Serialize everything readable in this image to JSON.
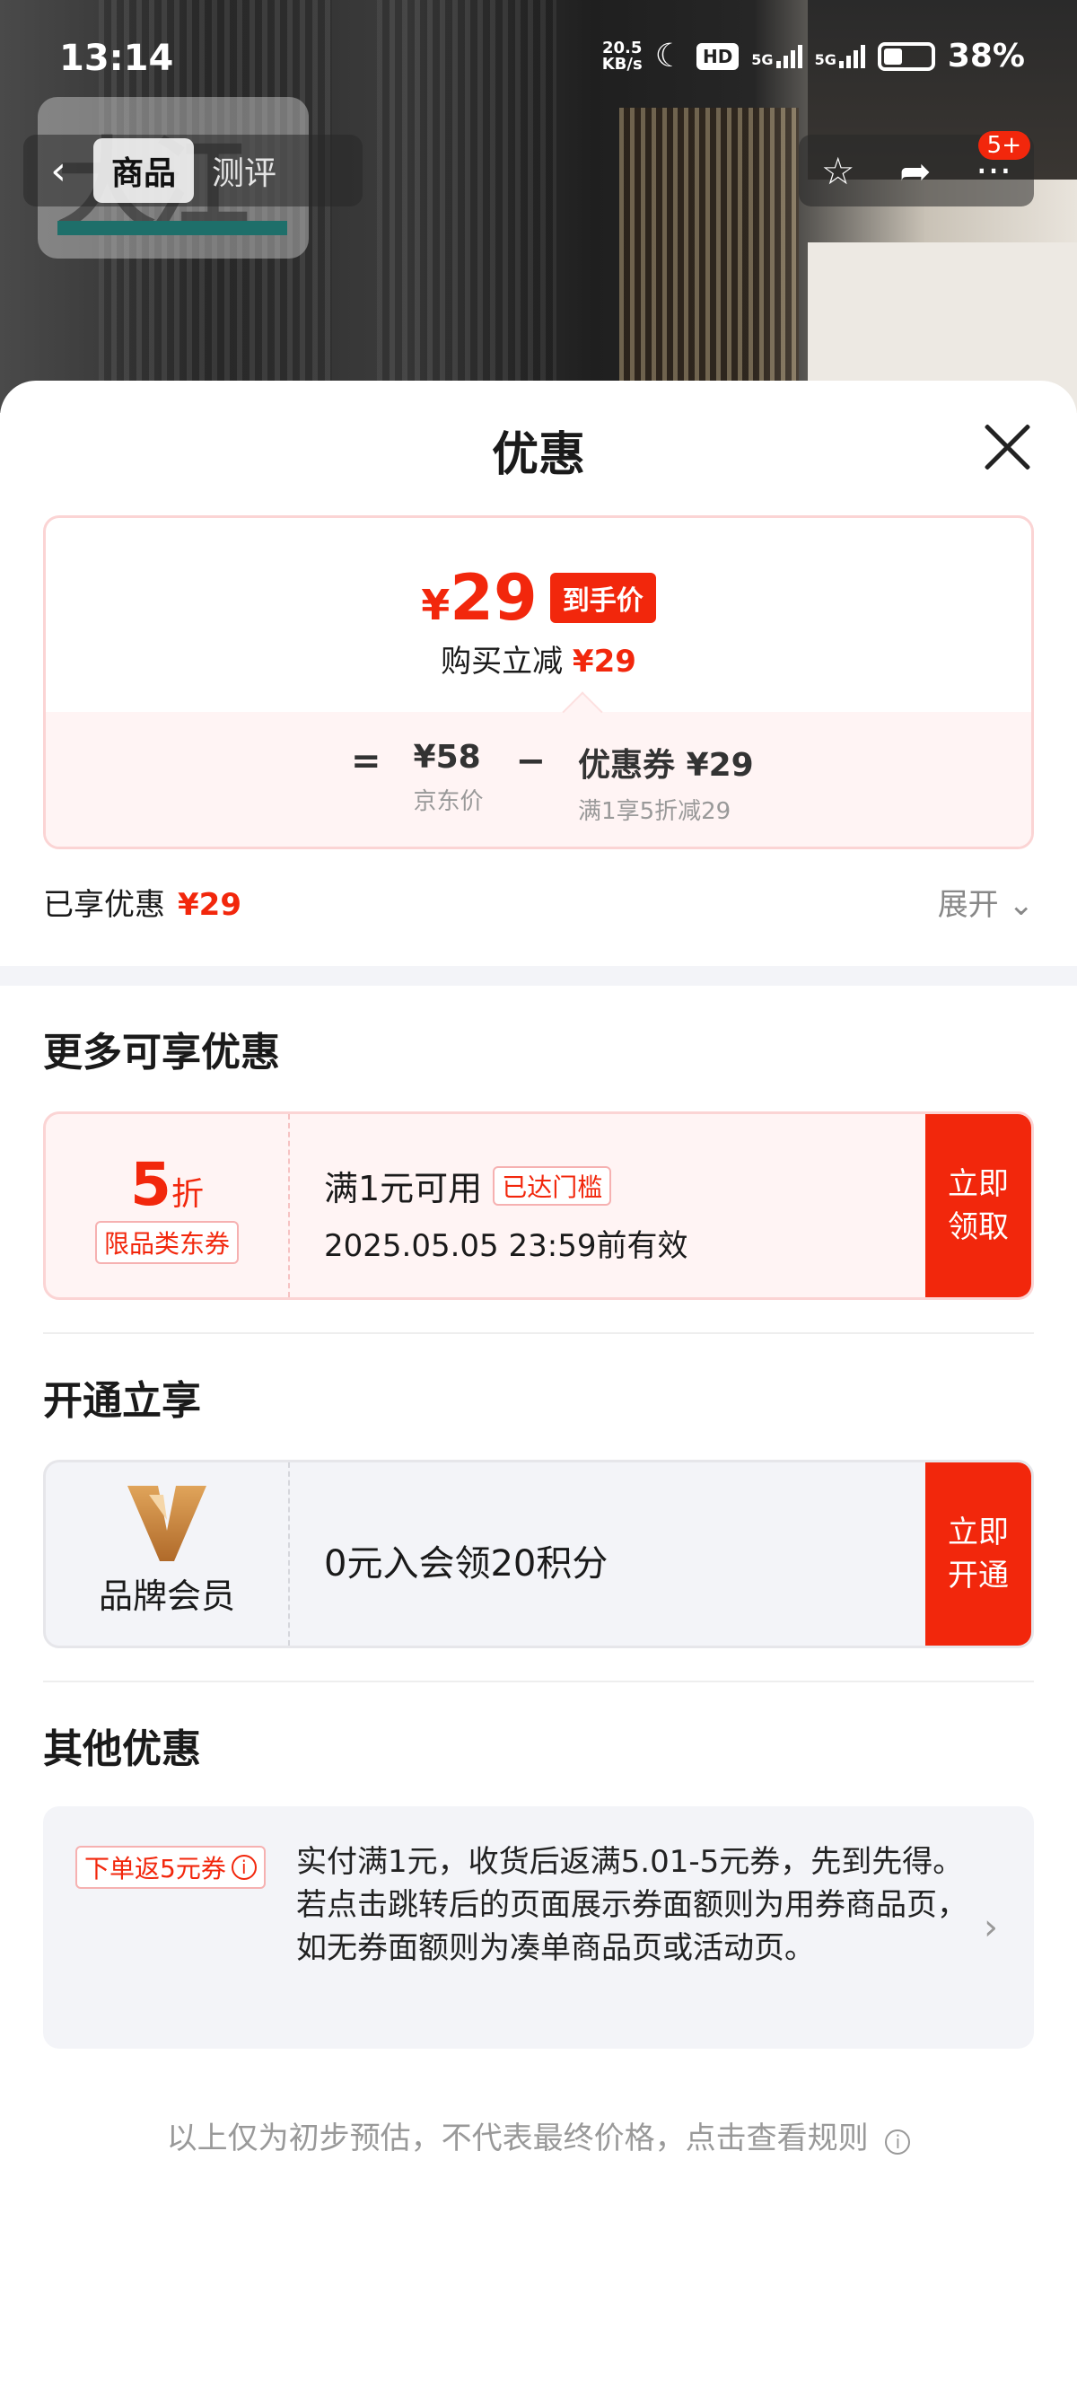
{
  "status_bar": {
    "time": "13:14",
    "net_speed_value": "20.5",
    "net_speed_unit": "KB/s",
    "hd_label": "HD",
    "sim1": "5G",
    "sim2": "5G",
    "battery": "38%"
  },
  "background": {
    "watermark_text": "大江"
  },
  "nav": {
    "back_icon": "chevron-left-icon",
    "tabs": [
      "商品",
      "测评"
    ],
    "active_tab": "商品",
    "badge": "5+"
  },
  "sheet": {
    "title": "优惠",
    "close_icon": "close-icon"
  },
  "price": {
    "currency": "¥",
    "final_amount": "29",
    "final_tag": "到手价",
    "sub_label": "购买立减",
    "sub_value": "¥29",
    "equals": "=",
    "minus": "−",
    "jd_price": "¥58",
    "jd_price_label": "京东价",
    "coupon_value": "优惠券 ¥29",
    "coupon_label": "满1享5折减29"
  },
  "enjoyed": {
    "label": "已享优惠",
    "value": "¥29",
    "expand_label": "展开"
  },
  "more_offers": {
    "title": "更多可享优惠",
    "coupon": {
      "discount_number": "5",
      "discount_unit": "折",
      "scope": "限品类东券",
      "condition": "满1元可用",
      "reached_tag": "已达门槛",
      "validity": "2025.05.05 23:59前有效",
      "action_line1": "立即",
      "action_line2": "领取"
    }
  },
  "open_membership": {
    "title": "开通立享",
    "brand_label": "品牌会员",
    "benefit": "0元入会领20积分",
    "action_line1": "立即",
    "action_line2": "开通"
  },
  "other_offers": {
    "title": "其他优惠",
    "tag": "下单返5元券",
    "text": "实付满1元，收货后返满5.01-5元券，先到先得。若点击跳转后的页面展示券面额则为用券商品页，如无券面额则为凑单商品页或活动页。"
  },
  "footnote": "以上仅为初步预估，不代表最终价格，点击查看规则",
  "colors": {
    "accent_red": "#f2270c",
    "light_red_bg": "#fff4f4",
    "gray_bg": "#f3f4f8"
  }
}
